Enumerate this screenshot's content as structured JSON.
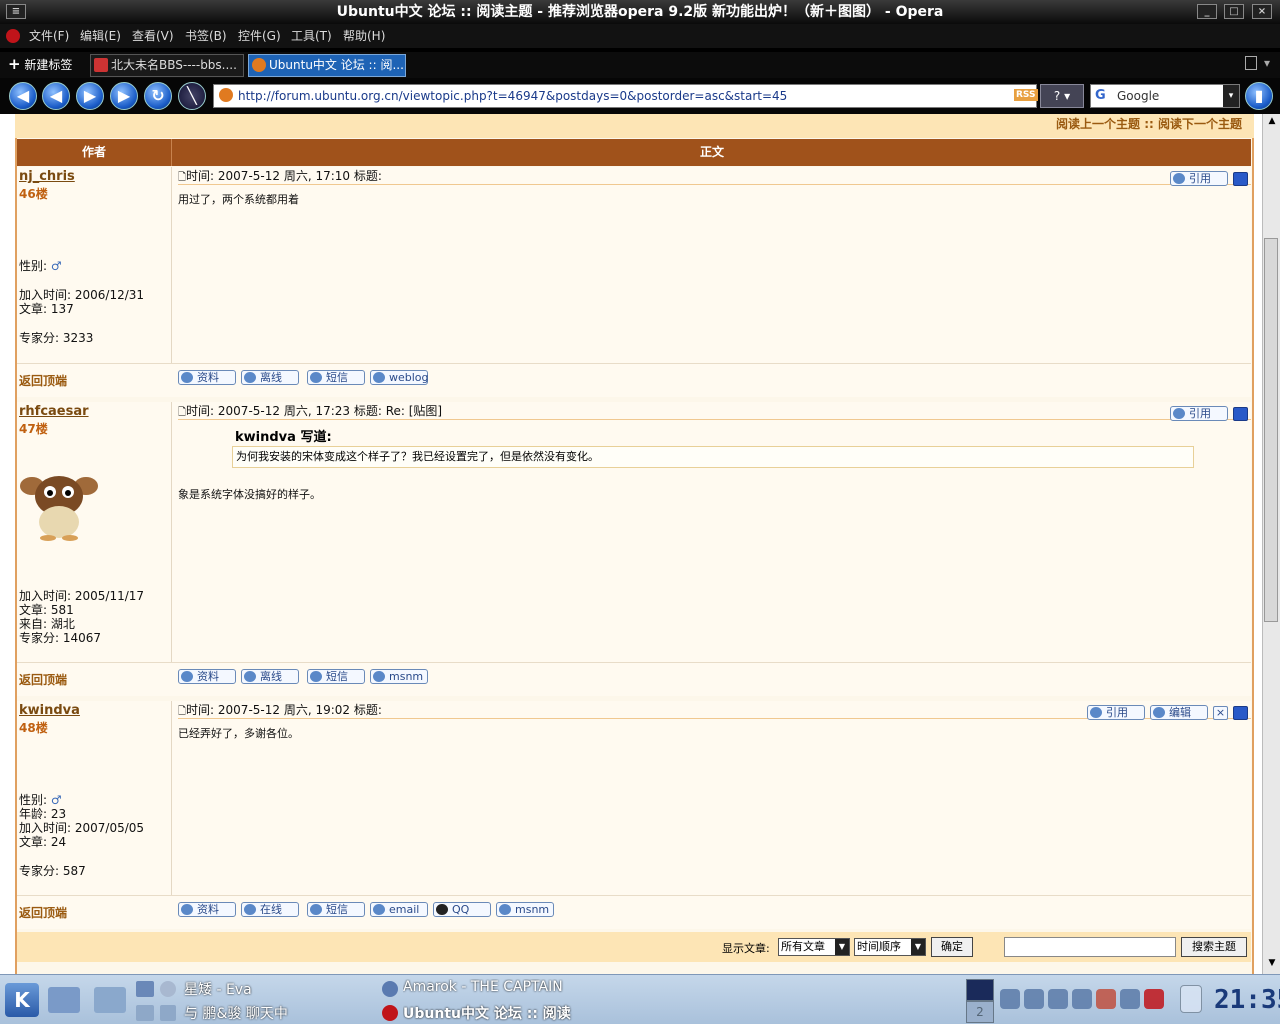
{
  "window": {
    "title": "Ubuntu中文 论坛 :: 阅读主题 - 推荐浏览器opera 9.2版 新功能出炉！（新＋图图） - Opera"
  },
  "menu": [
    "文件(F)",
    "编辑(E)",
    "查看(V)",
    "书签(B)",
    "控件(G)",
    "工具(T)",
    "帮助(H)"
  ],
  "tabs": {
    "new_tab": "新建标签",
    "items": [
      "北大未名BBS----bbs....",
      "Ubuntu中文 论坛 :: 阅..."
    ]
  },
  "address": {
    "url": "http://forum.ubuntu.org.cn/viewtopic.php?t=46947&postdays=0&postorder=asc&start=45",
    "rss": "RSS",
    "search_engine": "Google"
  },
  "topic_nav": {
    "prev": "阅读上一个主题",
    "sep": "::",
    "next": "阅读下一个主题"
  },
  "table": {
    "author_header": "作者",
    "body_header": "正文"
  },
  "labels": {
    "back_to_top": "返回顶端",
    "quote": "引用",
    "edit": "编辑",
    "profile": "资料",
    "offline": "离线",
    "online": "在线",
    "pm": "短信",
    "weblog": "weblog",
    "msnm": "msnm",
    "email": "email",
    "qq": "QQ"
  },
  "posts": [
    {
      "author": "nj_chris",
      "floor": "46楼",
      "gender": "性别:",
      "joined": "加入时间: 2006/12/31",
      "articles": "文章: 137",
      "points": "专家分: 3233",
      "header": "时间: 2007-5-12 周六, 17:10    标题:",
      "body": "用过了，两个系统都用着"
    },
    {
      "author": "rhfcaesar",
      "floor": "47楼",
      "joined": "加入时间: 2005/11/17",
      "articles": "文章: 581",
      "from": "来自: 湖北",
      "points": "专家分: 14067",
      "header": "时间: 2007-5-12 周六, 17:23    标题: Re: [贴图]",
      "quote_author": "kwindva 写道:",
      "quote_text": "为何我安装的宋体变成这个样子了？我已经设置完了，但是依然没有变化。",
      "body": "象是系统字体没搞好的样子。"
    },
    {
      "author": "kwindva",
      "floor": "48楼",
      "gender": "性别:",
      "age": "年龄: 23",
      "joined": "加入时间: 2007/05/05",
      "articles": "文章: 24",
      "points": "专家分: 587",
      "header": "时间: 2007-5-12 周六, 19:02    标题:",
      "body": "已经弄好了，多谢各位。"
    }
  ],
  "footer": {
    "show_label": "显示文章:",
    "filter": "所有文章",
    "order": "时间顺序",
    "ok": "确定",
    "search_btn": "搜索主题"
  },
  "taskbar": {
    "win1": "星矮 - Eva",
    "win2": "与 鹏&骏 聊天中",
    "win3": "Amarok - THE CAPTAIN",
    "win4": "Ubuntu中文 论坛 :: 阅读",
    "desk": "2",
    "clock": "21:35"
  }
}
